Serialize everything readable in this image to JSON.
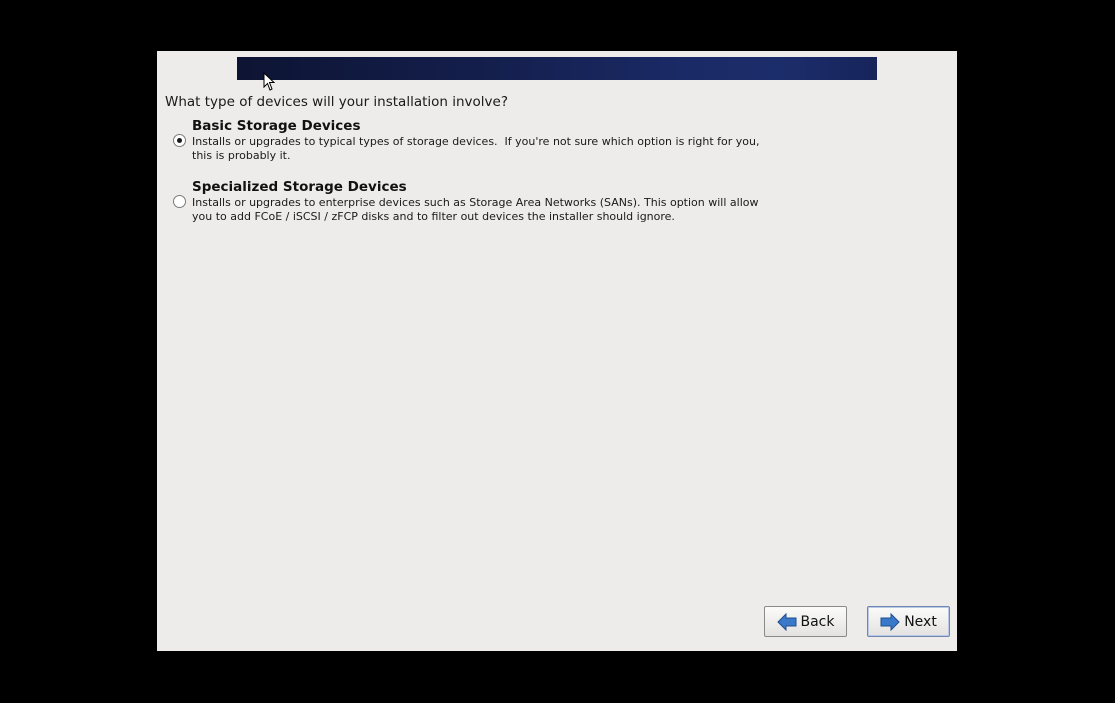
{
  "page": {
    "question": "What type of devices will your installation involve?"
  },
  "options": [
    {
      "title": "Basic Storage Devices",
      "description": "Installs or upgrades to typical types of storage devices.  If you're not sure which option is right for you,\nthis is probably it.",
      "selected": true
    },
    {
      "title": "Specialized Storage Devices",
      "description": "Installs or upgrades to enterprise devices such as Storage Area Networks (SANs). This option will allow\nyou to add FCoE / iSCSI / zFCP disks and to filter out devices the installer should ignore.",
      "selected": false
    }
  ],
  "buttons": {
    "back_label": "Back",
    "next_label": "Next"
  },
  "colors": {
    "banner": "#141f4d",
    "background": "#edeceb",
    "icon_blue": "#2f6fbf"
  }
}
